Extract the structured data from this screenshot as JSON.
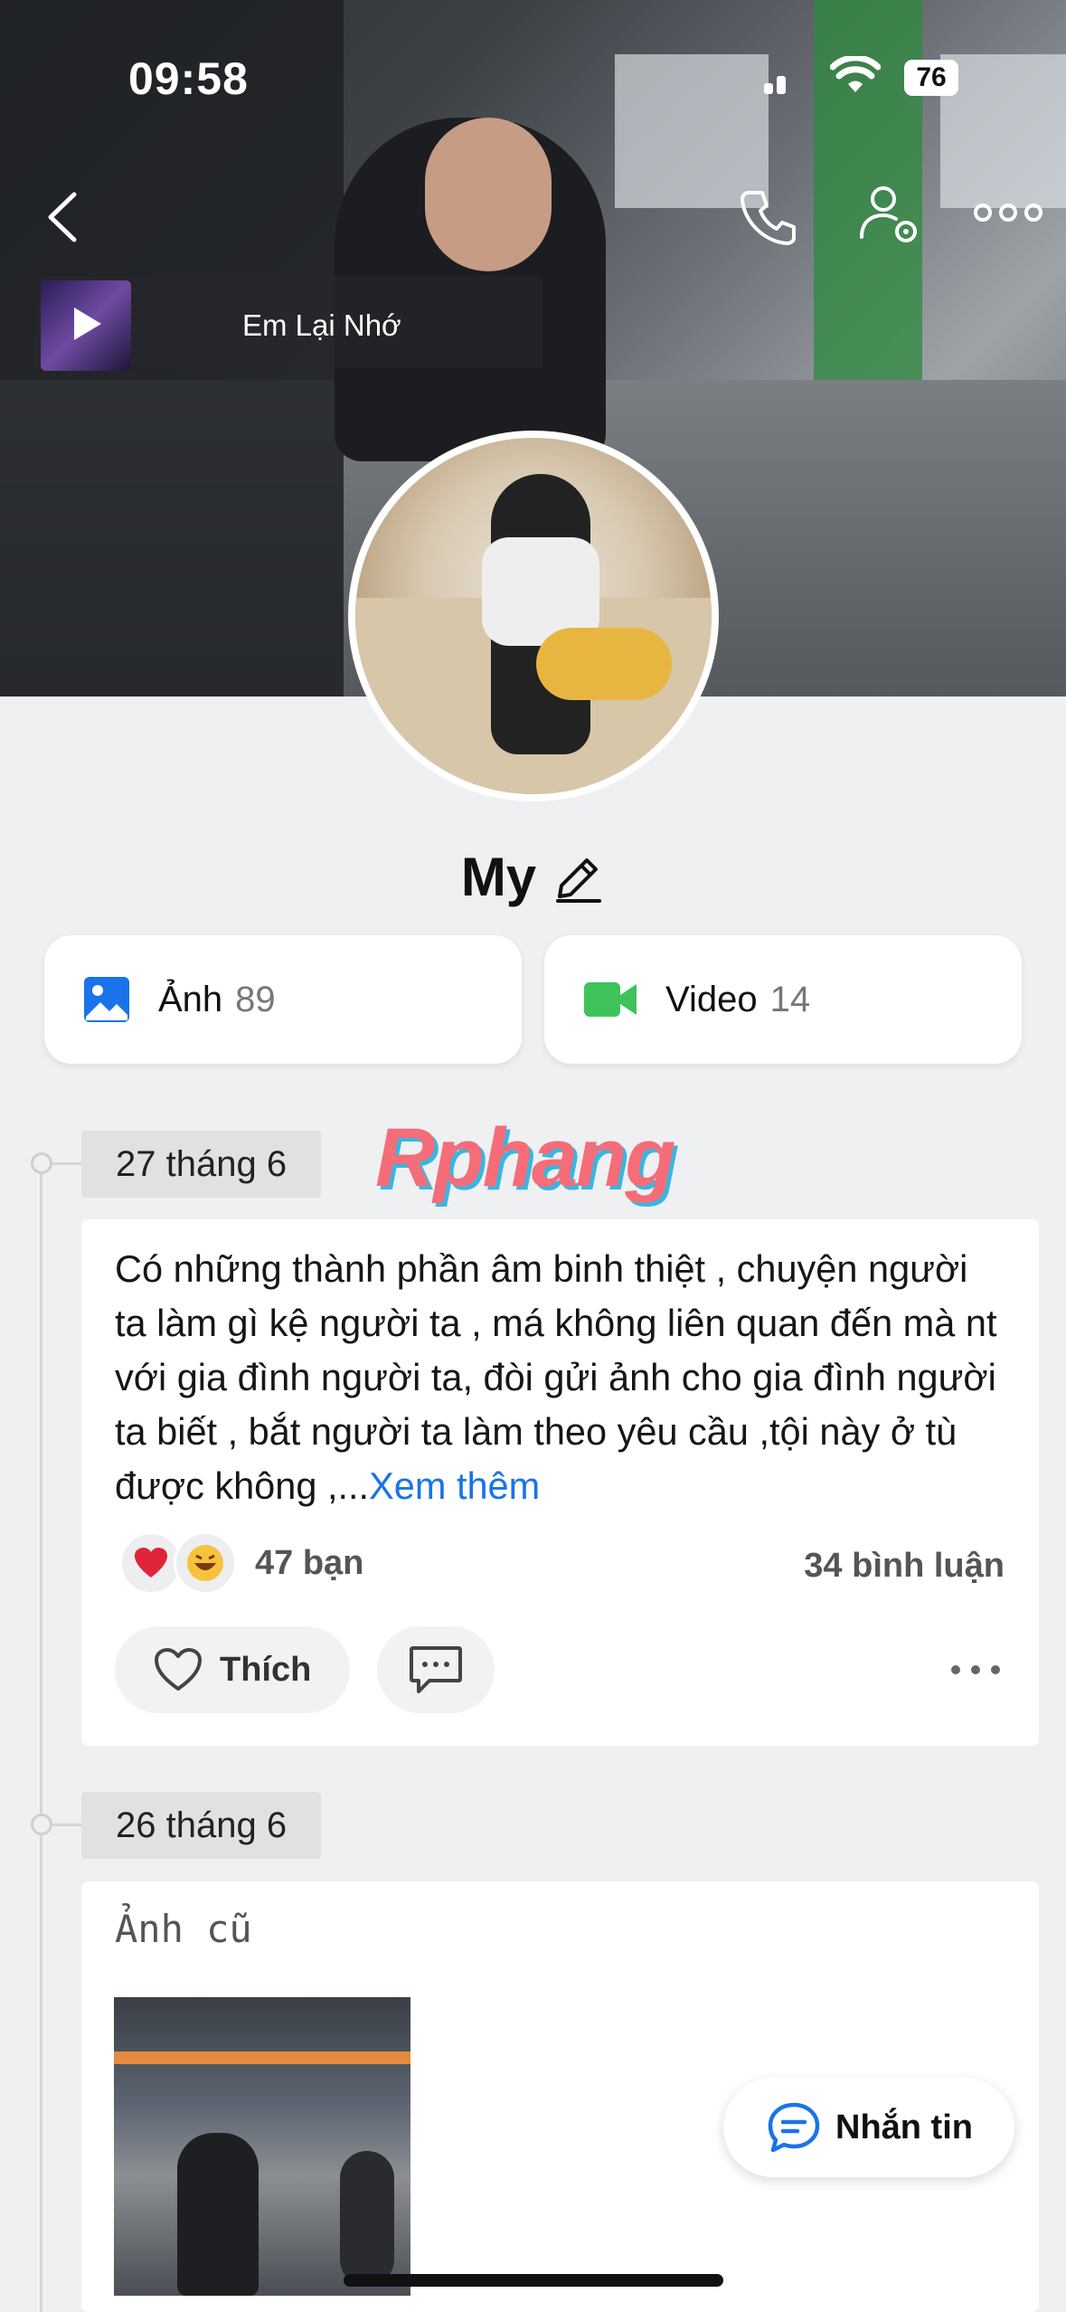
{
  "status_bar": {
    "time": "09:58",
    "battery": "76"
  },
  "music": {
    "title": "Em Lại Nhớ"
  },
  "profile": {
    "name": "My"
  },
  "media": {
    "photos_label": "Ảnh",
    "photos_count": "89",
    "videos_label": "Video",
    "videos_count": "14"
  },
  "watermark": "Rphang",
  "posts": [
    {
      "date": "27 tháng 6",
      "text": "Có những thành phần âm binh thiệt , chuyện người ta làm gì kệ người ta , má không liên quan đến mà nt với gia đình người ta, đòi gửi ảnh cho gia đình người ta biết , bắt người ta làm theo yêu cầu ,tội này ở tù được không ,...",
      "see_more": "Xem thêm",
      "reaction_count": "47 bạn",
      "comment_count": "34 bình luận",
      "like_label": "Thích"
    },
    {
      "date": "26 tháng 6",
      "text": "Ảnh cũ"
    }
  ],
  "message_button": "Nhắn tin",
  "colors": {
    "link": "#1a73e8",
    "photo_icon": "#1a73e8",
    "video_icon": "#3ec35a",
    "heart": "#e0253a"
  }
}
